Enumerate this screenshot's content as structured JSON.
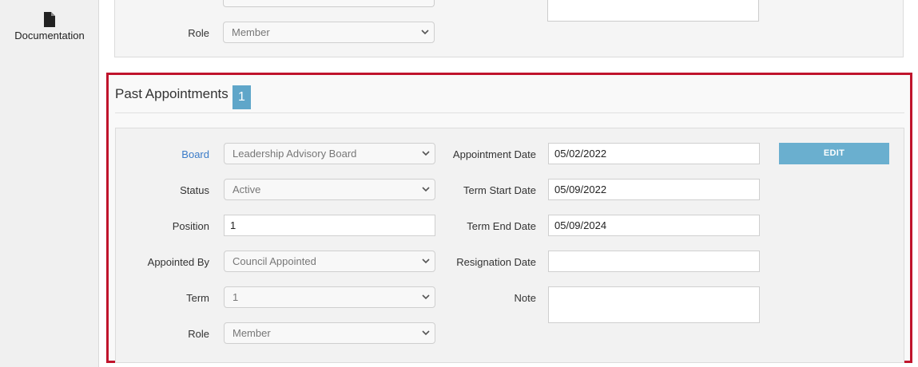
{
  "sidebar": {
    "documentation_label": "Documentation",
    "documentation_icon": "document-icon"
  },
  "top_card": {
    "role_label": "Role",
    "role_value": "Member"
  },
  "past_appointments": {
    "title": "Past Appointments",
    "count": "1",
    "edit_label": "EDIT",
    "fields": {
      "board_label": "Board",
      "board_value": "Leadership Advisory Board",
      "status_label": "Status",
      "status_value": "Active",
      "position_label": "Position",
      "position_value": "1",
      "appointed_by_label": "Appointed By",
      "appointed_by_value": "Council Appointed",
      "term_label": "Term",
      "term_value": "1",
      "role_label": "Role",
      "role_value": "Member",
      "appointment_date_label": "Appointment Date",
      "appointment_date_value": "05/02/2022",
      "term_start_label": "Term Start Date",
      "term_start_value": "05/09/2022",
      "term_end_label": "Term End Date",
      "term_end_value": "05/09/2024",
      "resignation_label": "Resignation Date",
      "resignation_value": "",
      "note_label": "Note",
      "note_value": ""
    }
  },
  "colors": {
    "highlight_border": "#c0142c",
    "accent": "#5fa6c9",
    "edit_button": "#6aafcf",
    "link": "#3a7bc8"
  }
}
